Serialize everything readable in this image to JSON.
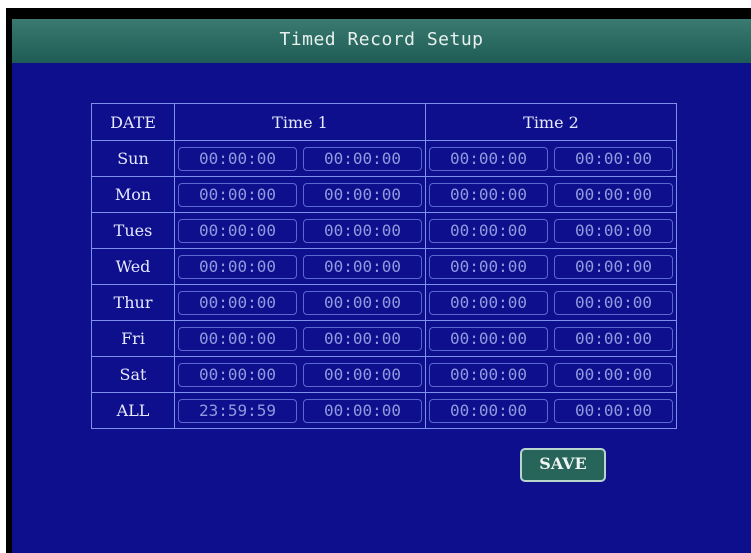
{
  "title": "Timed Record Setup",
  "headers": {
    "date": "DATE",
    "time1": "Time 1",
    "time2": "Time 2"
  },
  "rows": [
    {
      "day": "Sun",
      "t1_start": "00:00:00",
      "t1_end": "00:00:00",
      "t2_start": "00:00:00",
      "t2_end": "00:00:00"
    },
    {
      "day": "Mon",
      "t1_start": "00:00:00",
      "t1_end": "00:00:00",
      "t2_start": "00:00:00",
      "t2_end": "00:00:00"
    },
    {
      "day": "Tues",
      "t1_start": "00:00:00",
      "t1_end": "00:00:00",
      "t2_start": "00:00:00",
      "t2_end": "00:00:00"
    },
    {
      "day": "Wed",
      "t1_start": "00:00:00",
      "t1_end": "00:00:00",
      "t2_start": "00:00:00",
      "t2_end": "00:00:00"
    },
    {
      "day": "Thur",
      "t1_start": "00:00:00",
      "t1_end": "00:00:00",
      "t2_start": "00:00:00",
      "t2_end": "00:00:00"
    },
    {
      "day": "Fri",
      "t1_start": "00:00:00",
      "t1_end": "00:00:00",
      "t2_start": "00:00:00",
      "t2_end": "00:00:00"
    },
    {
      "day": "Sat",
      "t1_start": "00:00:00",
      "t1_end": "00:00:00",
      "t2_start": "00:00:00",
      "t2_end": "00:00:00"
    },
    {
      "day": "ALL",
      "t1_start": "23:59:59",
      "t1_end": "00:00:00",
      "t2_start": "00:00:00",
      "t2_end": "00:00:00"
    }
  ],
  "save_label": "SAVE",
  "colors": {
    "background": "#0d0f8c",
    "title_bar": "#2a6b63",
    "grid_line": "#7e90ee",
    "field_text": "#8f9adf",
    "save_button": "#27645a"
  }
}
